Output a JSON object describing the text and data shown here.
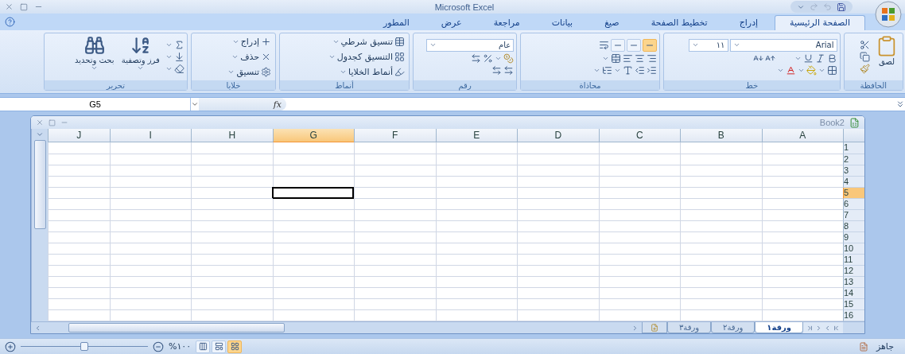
{
  "window": {
    "title": "Microsoft Excel"
  },
  "tabs": [
    {
      "label": "الصفحة الرئيسية",
      "selected": true
    },
    {
      "label": "إدراج",
      "selected": false
    },
    {
      "label": "تخطيط الصفحة",
      "selected": false
    },
    {
      "label": "صيغ",
      "selected": false
    },
    {
      "label": "بيانات",
      "selected": false
    },
    {
      "label": "مراجعة",
      "selected": false
    },
    {
      "label": "عرض",
      "selected": false
    },
    {
      "label": "المطور",
      "selected": false
    }
  ],
  "ribbon": {
    "groups": [
      {
        "kind": "clipboard",
        "label": "الحافظة",
        "paste": "لصق"
      },
      {
        "kind": "font",
        "label": "خط",
        "font": "Arial",
        "size": "١١"
      },
      {
        "kind": "alignment",
        "label": "محاذاة",
        "vertical_options": [
          {
            "selected": true
          },
          {
            "selected": false
          },
          {
            "selected": false
          }
        ]
      },
      {
        "kind": "number",
        "label": "رقم",
        "format": "عام"
      },
      {
        "kind": "styles",
        "label": "أنماط",
        "commands": [
          "تنسيق شرطي",
          "التنسيق كجدول",
          "أنماط الخلايا"
        ]
      },
      {
        "kind": "cells",
        "label": "خلايا",
        "commands": [
          "إدراج",
          "حذف",
          "تنسيق"
        ]
      },
      {
        "kind": "editing",
        "label": "تحرير",
        "commands": [
          "فرز وتصفية",
          "بحث وتحديد"
        ]
      }
    ]
  },
  "formula_bar": {
    "name_box": "G5",
    "function_label": "fx"
  },
  "workbook": {
    "title": "Book2",
    "columns": [
      {
        "label": "A",
        "selected": false
      },
      {
        "label": "B",
        "selected": false
      },
      {
        "label": "C",
        "selected": false
      },
      {
        "label": "D",
        "selected": false
      },
      {
        "label": "E",
        "selected": false
      },
      {
        "label": "F",
        "selected": false
      },
      {
        "label": "G",
        "selected": true
      },
      {
        "label": "H",
        "selected": false
      },
      {
        "label": "I",
        "selected": false
      },
      {
        "label": "J",
        "selected": false
      }
    ],
    "rows": [
      {
        "label": "1",
        "selected": false
      },
      {
        "label": "2",
        "selected": false
      },
      {
        "label": "3",
        "selected": false
      },
      {
        "label": "4",
        "selected": false
      },
      {
        "label": "5",
        "selected": true
      },
      {
        "label": "6",
        "selected": false
      },
      {
        "label": "7",
        "selected": false
      },
      {
        "label": "8",
        "selected": false
      },
      {
        "label": "9",
        "selected": false
      },
      {
        "label": "10",
        "selected": false
      },
      {
        "label": "11",
        "selected": false
      },
      {
        "label": "12",
        "selected": false
      },
      {
        "label": "13",
        "selected": false
      },
      {
        "label": "14",
        "selected": false
      },
      {
        "label": "15",
        "selected": false
      },
      {
        "label": "16",
        "selected": false
      }
    ],
    "sheets": [
      {
        "label": "ورقة١",
        "selected": true
      },
      {
        "label": "ورقة٢",
        "selected": false
      },
      {
        "label": "ورقة٣",
        "selected": false
      }
    ]
  },
  "status_bar": {
    "status": "جاهز",
    "zoom": "%١٠٠",
    "zoom_slider": {
      "level": 0.5
    },
    "views": [
      {
        "selected": true
      },
      {
        "selected": false
      },
      {
        "selected": false
      }
    ]
  }
}
